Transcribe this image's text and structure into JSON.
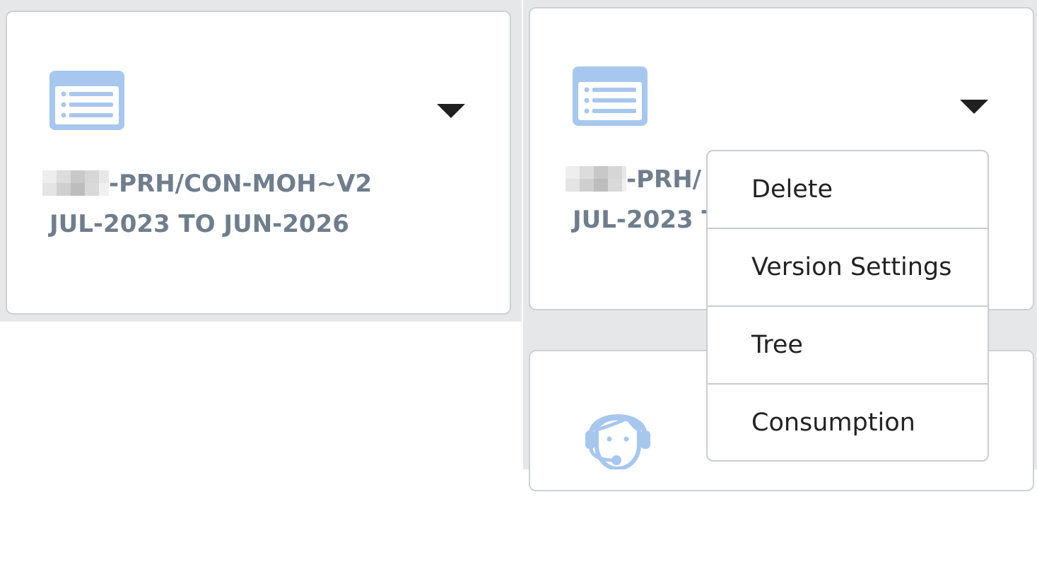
{
  "colors": {
    "icon_blue": "#a8c7ee",
    "title_gray": "#6f7d8c",
    "panel_gray": "#e6e7e9",
    "caret": "#202020"
  },
  "cards": [
    {
      "icon": "document-list-icon",
      "name_suffix": "-PRH/CON-MOH~V2",
      "period": "JUL-2023 TO JUN-2026"
    },
    {
      "icon": "document-list-icon",
      "name_suffix": "-PRH/",
      "period": "JUL-2023 T"
    }
  ],
  "menu": {
    "items": [
      {
        "label": "Delete"
      },
      {
        "label": "Version Settings"
      },
      {
        "label": "Tree"
      },
      {
        "label": "Consumption"
      }
    ]
  },
  "lower_card": {
    "icon": "support-agent-icon"
  }
}
